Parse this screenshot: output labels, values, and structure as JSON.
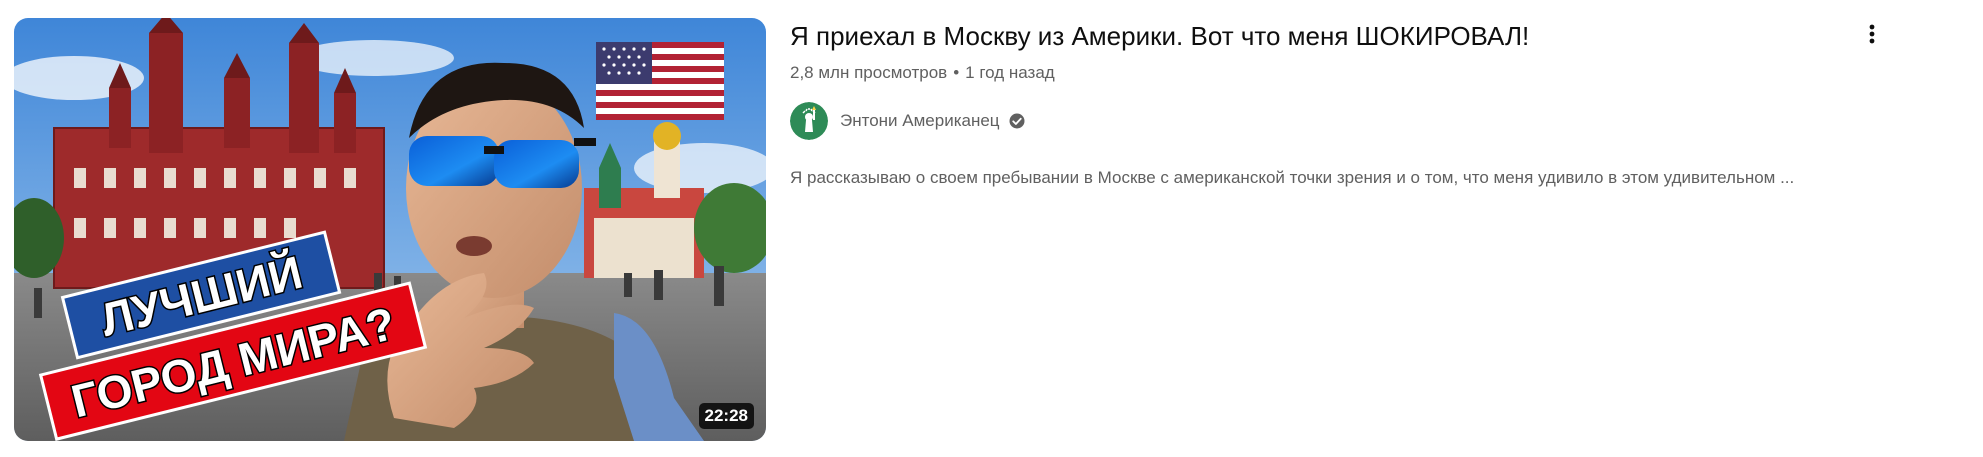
{
  "video": {
    "title": "Я приехал в Москву из Америки. Вот что меня ШОКИРОВАЛ!",
    "views": "2,8 млн просмотров",
    "separator": "•",
    "published": "1 год назад",
    "duration": "22:28",
    "description": "Я рассказываю о своем пребывании в Москве с американской точки зрения и о том, что меня удивило в этом удивительном ...",
    "thumbnail_text": {
      "line1": "ЛУЧШИЙ",
      "line2": "ГОРОД МИРА?"
    }
  },
  "channel": {
    "name": "Энтони Американец",
    "verified_icon": "verified-check-icon",
    "avatar_icon": "statue-of-liberty-avatar"
  },
  "menu": {
    "icon": "more-vert-icon"
  },
  "colors": {
    "title": "#0f0f0f",
    "secondary": "#606060",
    "thumb_banner_blue": "#1e4fa3",
    "thumb_banner_red": "#e30613",
    "avatar_bg": "#2e8b57"
  }
}
